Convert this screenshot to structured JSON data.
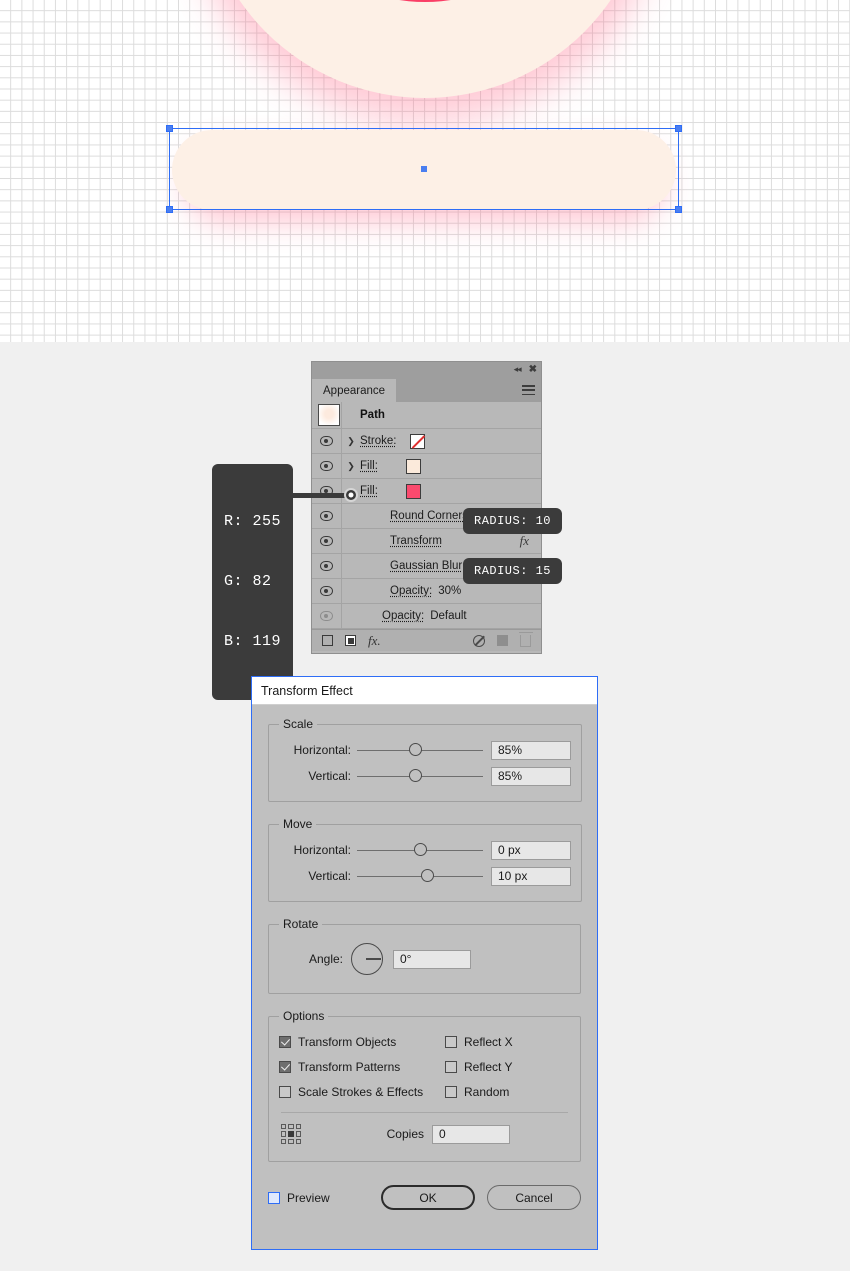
{
  "canvas": {
    "name": "artboard",
    "selection": {
      "handles": 4,
      "center_anchor": true
    }
  },
  "appearance_panel": {
    "tab_label": "Appearance",
    "title_icons": {
      "collapse": "collapse-icon",
      "close": "close-icon",
      "menu": "panel-menu-icon"
    },
    "item_title": "Path",
    "rows": [
      {
        "label": "Stroke:",
        "swatch": "none",
        "eye": "visible",
        "arrow": true
      },
      {
        "label": "Fill:",
        "swatch": "cream",
        "eye": "visible",
        "arrow": true
      },
      {
        "label": "Fill:",
        "swatch": "pink",
        "eye": "visible",
        "arrow": false
      },
      {
        "label": "Round Corners",
        "eye": "visible"
      },
      {
        "label": "Transform",
        "eye": "visible",
        "fx": "fx"
      },
      {
        "label": "Gaussian Blur",
        "eye": "visible"
      },
      {
        "label": "Opacity:",
        "value": "30%",
        "eye": "visible"
      },
      {
        "label": "Opacity:",
        "value": "Default",
        "eye": "hidden"
      }
    ],
    "footer_icons": [
      "new-stroke-icon",
      "new-fill-icon",
      "add-effect-icon",
      "clear-appearance-icon",
      "duplicate-item-icon",
      "delete-item-icon"
    ]
  },
  "callouts": {
    "rgb": {
      "r": "R: 255",
      "g": "G: 82",
      "b": "B: 119"
    },
    "round_corners_radius": "RADIUS: 10",
    "gaussian_blur_radius": "RADIUS: 15"
  },
  "dialog": {
    "title": "Transform Effect",
    "scale": {
      "legend": "Scale",
      "horizontal_label": "Horizontal:",
      "horizontal_value": "85%",
      "vertical_label": "Vertical:",
      "vertical_value": "85%"
    },
    "move": {
      "legend": "Move",
      "horizontal_label": "Horizontal:",
      "horizontal_value": "0 px",
      "vertical_label": "Vertical:",
      "vertical_value": "10 px"
    },
    "rotate": {
      "legend": "Rotate",
      "angle_label": "Angle:",
      "angle_value": "0°"
    },
    "options": {
      "legend": "Options",
      "transform_objects": "Transform Objects",
      "transform_patterns": "Transform Patterns",
      "scale_strokes": "Scale Strokes & Effects",
      "reflect_x": "Reflect X",
      "reflect_y": "Reflect Y",
      "random": "Random",
      "copies_label": "Copies",
      "copies_value": "0"
    },
    "footer": {
      "preview_label": "Preview",
      "ok_label": "OK",
      "cancel_label": "Cancel"
    }
  },
  "colors": {
    "accent_pink": "#fa3e66",
    "cream": "#fdf0e6",
    "selection_blue": "#2e6df6",
    "panel_gray": "#b8b8b8",
    "dialog_gray": "#c0c0c0"
  }
}
